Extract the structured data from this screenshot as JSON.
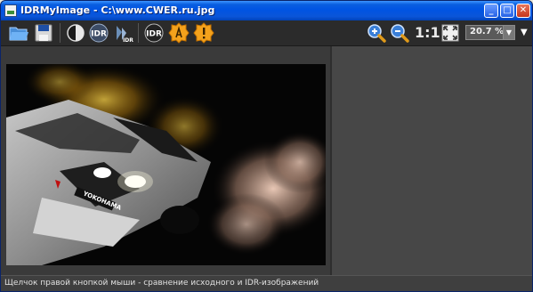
{
  "window": {
    "title": "IDRMyImage - C:\\www.CWER.ru.jpg",
    "minimize": "_",
    "maximize": "□",
    "close": "✕"
  },
  "toolbar": {
    "zoom_actual": "1:1",
    "zoom_value": "20.7 %",
    "zoom_dropdown_arrow": "▼",
    "overflow_arrow": "▼",
    "icons": [
      "folder-open-icon",
      "save-icon",
      "compare-icon",
      "idr-icon",
      "idr-split-icon",
      "idr-process-icon",
      "settings-a-icon",
      "info-icon",
      "zoom-in-icon",
      "zoom-out-icon",
      "fit-screen-icon"
    ],
    "idr_label": "IDR"
  },
  "image": {
    "brand_on_car": "YOKOHAMA"
  },
  "status": {
    "text": "Щелчок правой кнопкой мыши - сравнение исходного и IDR-изображений"
  },
  "colors": {
    "titlebar": "#0054e3",
    "toolbar": "#2b2b2b",
    "workspace": "#474747"
  }
}
